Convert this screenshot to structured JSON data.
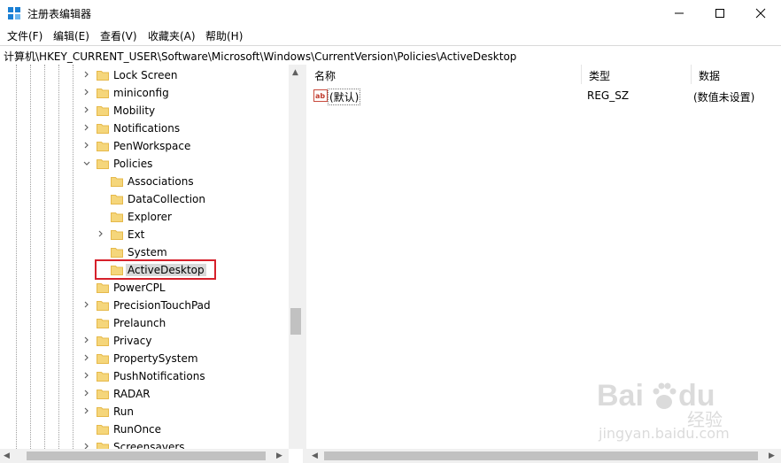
{
  "window": {
    "title": "注册表编辑器"
  },
  "menu": [
    "文件(F)",
    "编辑(E)",
    "查看(V)",
    "收藏夹(A)",
    "帮助(H)"
  ],
  "address": "计算机\\HKEY_CURRENT_USER\\Software\\Microsoft\\Windows\\CurrentVersion\\Policies\\ActiveDesktop",
  "tree": [
    {
      "label": "Lock Screen",
      "level": 0,
      "expander": "right"
    },
    {
      "label": "miniconfig",
      "level": 0,
      "expander": "right"
    },
    {
      "label": "Mobility",
      "level": 0,
      "expander": "right"
    },
    {
      "label": "Notifications",
      "level": 0,
      "expander": "right"
    },
    {
      "label": "PenWorkspace",
      "level": 0,
      "expander": "right"
    },
    {
      "label": "Policies",
      "level": 0,
      "expander": "down"
    },
    {
      "label": "Associations",
      "level": 1,
      "expander": "none"
    },
    {
      "label": "DataCollection",
      "level": 1,
      "expander": "none"
    },
    {
      "label": "Explorer",
      "level": 1,
      "expander": "none"
    },
    {
      "label": "Ext",
      "level": 1,
      "expander": "right"
    },
    {
      "label": "System",
      "level": 1,
      "expander": "none"
    },
    {
      "label": "ActiveDesktop",
      "level": 1,
      "expander": "none",
      "selected": true
    },
    {
      "label": "PowerCPL",
      "level": 0,
      "expander": "none"
    },
    {
      "label": "PrecisionTouchPad",
      "level": 0,
      "expander": "right"
    },
    {
      "label": "Prelaunch",
      "level": 0,
      "expander": "none"
    },
    {
      "label": "Privacy",
      "level": 0,
      "expander": "right"
    },
    {
      "label": "PropertySystem",
      "level": 0,
      "expander": "right"
    },
    {
      "label": "PushNotifications",
      "level": 0,
      "expander": "right"
    },
    {
      "label": "RADAR",
      "level": 0,
      "expander": "right"
    },
    {
      "label": "Run",
      "level": 0,
      "expander": "right"
    },
    {
      "label": "RunOnce",
      "level": 0,
      "expander": "none"
    },
    {
      "label": "Screensavers",
      "level": 0,
      "expander": "right"
    }
  ],
  "columns": {
    "name": "名称",
    "type": "类型",
    "data": "数据"
  },
  "values": [
    {
      "icon": "string-value-icon",
      "icon_text": "ab",
      "name": "(默认)",
      "type": "REG_SZ",
      "data": "(数值未设置)"
    }
  ],
  "watermark": {
    "brand": "Bai",
    "brand2": "du",
    "suffix": "经验",
    "url": "jingyan.baidu.com"
  },
  "colors": {
    "folder": "#f5d67b",
    "folder_dark": "#e6b94a",
    "highlight": "#d6212b",
    "selected_bg": "#d9d9d9"
  }
}
